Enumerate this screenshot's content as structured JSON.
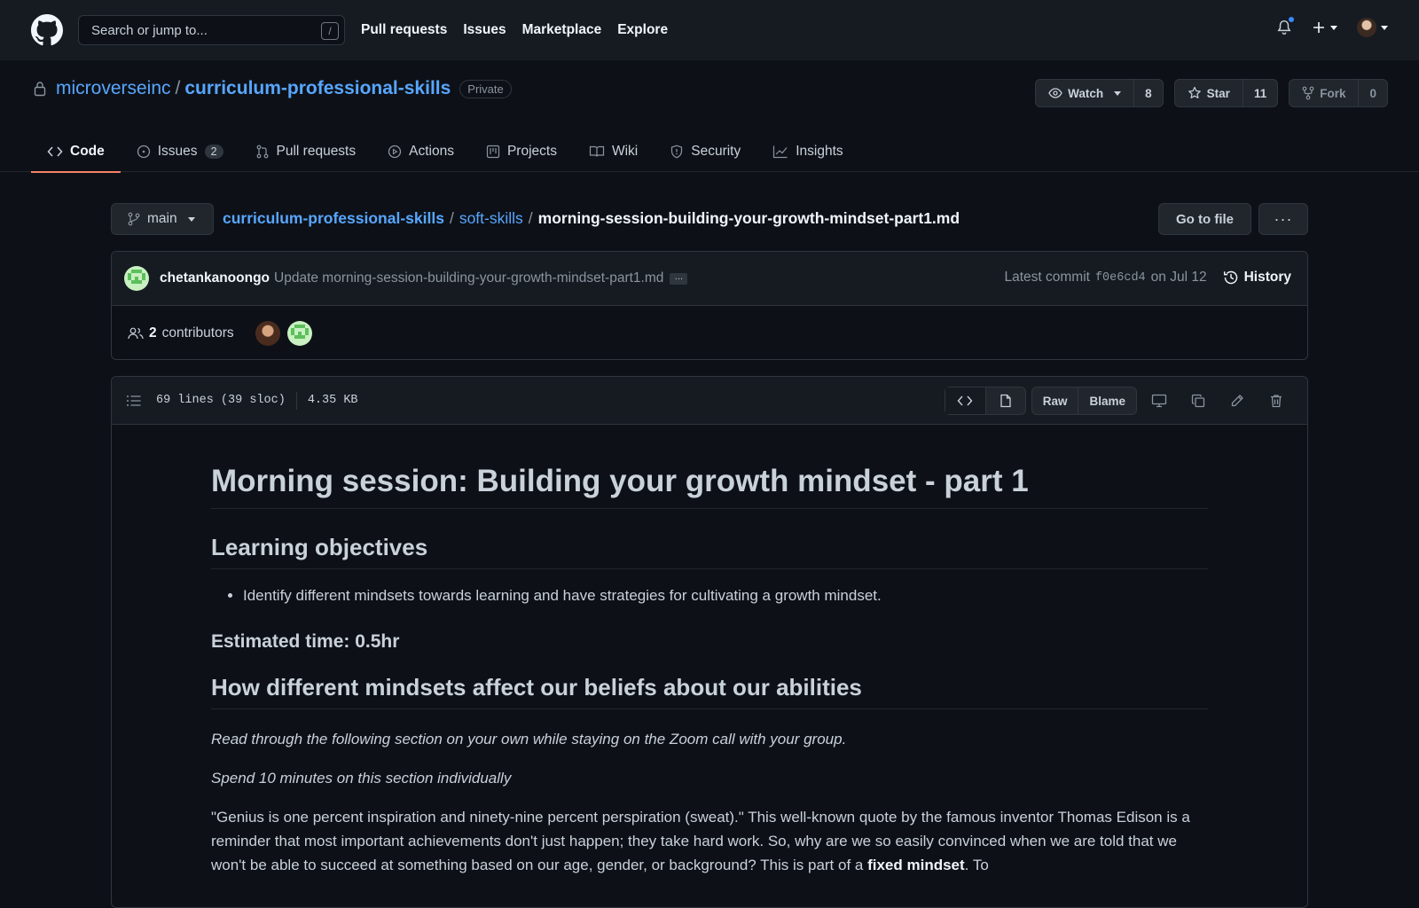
{
  "header": {
    "search_placeholder": "Search or jump to...",
    "search_key": "/",
    "nav": [
      "Pull requests",
      "Issues",
      "Marketplace",
      "Explore"
    ]
  },
  "repo": {
    "owner": "microverseinc",
    "separator": "/",
    "name": "curriculum-professional-skills",
    "visibility": "Private",
    "watch_label": "Watch",
    "watch_count": "8",
    "star_label": "Star",
    "star_count": "11",
    "fork_label": "Fork",
    "fork_count": "0",
    "tabs": [
      {
        "label": "Code",
        "icon": "code-icon"
      },
      {
        "label": "Issues",
        "icon": "issue-icon",
        "count": "2"
      },
      {
        "label": "Pull requests",
        "icon": "pull-request-icon"
      },
      {
        "label": "Actions",
        "icon": "play-icon"
      },
      {
        "label": "Projects",
        "icon": "project-icon"
      },
      {
        "label": "Wiki",
        "icon": "book-icon"
      },
      {
        "label": "Security",
        "icon": "shield-icon"
      },
      {
        "label": "Insights",
        "icon": "graph-icon"
      }
    ]
  },
  "filebar": {
    "branch": "main",
    "crumb_repo": "curriculum-professional-skills",
    "crumb_sep": "/",
    "crumb_folder": "soft-skills",
    "crumb_file": "morning-session-building-your-growth-mindset-part1.md",
    "goto_label": "Go to file",
    "more_label": "···"
  },
  "commit": {
    "author": "chetankanoongo",
    "message": "Update morning-session-building-your-growth-mindset-part1.md",
    "ellipsis": "…",
    "latest_label": "Latest commit",
    "sha": "f0e6cd4",
    "date": "on Jul 12",
    "history_label": "History",
    "contributors_count": "2",
    "contributors_label": "contributors"
  },
  "file": {
    "lines": "69 lines (39 sloc)",
    "size": "4.35 KB",
    "raw_label": "Raw",
    "blame_label": "Blame"
  },
  "markdown": {
    "h1": "Morning session: Building your growth mindset - part 1",
    "h2_objectives": "Learning objectives",
    "objective_1": "Identify different mindsets towards learning and have strategies for cultivating a growth mindset.",
    "h3_time": "Estimated time: 0.5hr",
    "h2_mindsets": "How different mindsets affect our beliefs about our abilities",
    "p_italic_1": "Read through the following section on your own while staying on the Zoom call with your group.",
    "p_italic_2": "Spend 10 minutes on this section individually",
    "p_quote_a": "\"Genius is one percent inspiration and ninety-nine percent perspiration (sweat).\" This well-known quote by the famous inventor Thomas Edison is a reminder that most important achievements don't just happen; they take hard work. So, why are we so easily convinced when we are told that we won't be able to succeed at something based on our age, gender, or background? This is part of a ",
    "p_quote_bold": "fixed mindset",
    "p_quote_b": ". To"
  }
}
